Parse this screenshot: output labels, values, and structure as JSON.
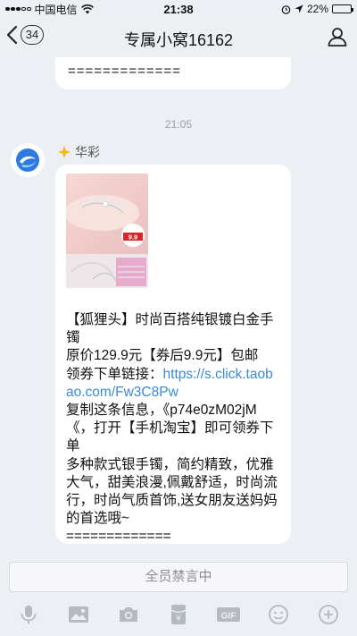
{
  "status_bar": {
    "carrier": "中国电信",
    "time": "21:38",
    "battery": "22%",
    "battery_level": 0.22
  },
  "nav": {
    "unread_count": "34",
    "title": "专属小窝16162"
  },
  "chat": {
    "previous_message_tail": "=============",
    "time_divider": "21:05",
    "sender": {
      "name": "华彩"
    },
    "message": {
      "image": {
        "badge_text": "9.9"
      },
      "line1": "【狐狸头】时尚百搭纯银镀白金手镯",
      "line2": "原价129.9元【券后9.9元】包邮",
      "line3_prefix": "领券下单链接：",
      "link": "https://s.click.taobao.com/Fw3C8Pw",
      "line4": "复制这条信息，《p74e0zM02jM《，打开【手机淘宝】即可领券下单",
      "line5": "多种款式银手镯，简约精致，优雅大气，甜美浪漫,佩戴舒适，时尚流行，时尚气质首饰,送女朋友送妈妈的首选哦~",
      "line6": "============="
    }
  },
  "input": {
    "muted_label": "全员禁言中"
  },
  "toolbar": {
    "items": [
      "voice-icon",
      "image-icon",
      "camera-icon",
      "red-packet-icon",
      "gif-icon",
      "emoji-icon",
      "plus-icon"
    ],
    "gif_label": "GIF"
  },
  "colors": {
    "background": "#eceff3",
    "link": "#3a8ad6",
    "badge_red": "#d9262a"
  }
}
